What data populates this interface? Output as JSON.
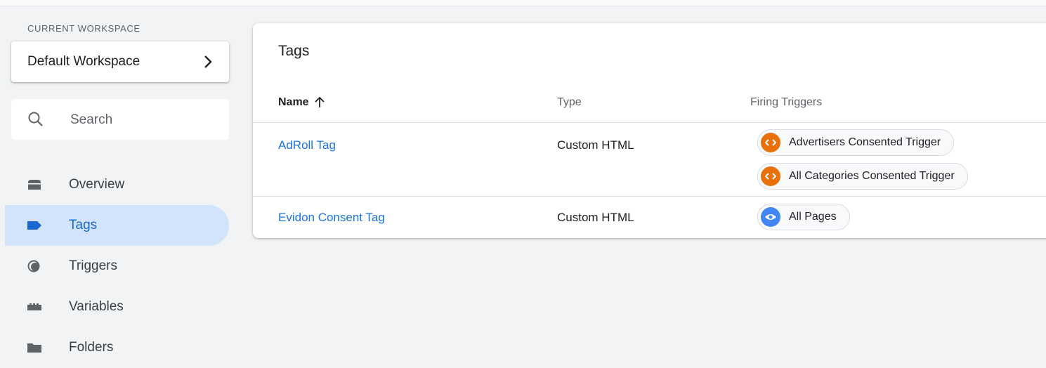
{
  "workspace": {
    "section_label": "CURRENT WORKSPACE",
    "name": "Default Workspace"
  },
  "search": {
    "placeholder": "Search"
  },
  "nav": {
    "items": [
      {
        "label": "Overview",
        "icon": "overview-icon",
        "active": false
      },
      {
        "label": "Tags",
        "icon": "tag-icon",
        "active": true
      },
      {
        "label": "Triggers",
        "icon": "trigger-icon",
        "active": false
      },
      {
        "label": "Variables",
        "icon": "variables-icon",
        "active": false
      },
      {
        "label": "Folders",
        "icon": "folder-icon",
        "active": false
      }
    ]
  },
  "main": {
    "title": "Tags",
    "columns": {
      "name": "Name",
      "type": "Type",
      "triggers": "Firing Triggers"
    },
    "sort": {
      "column": "name",
      "direction": "ascending",
      "icon": "arrow-up-icon"
    },
    "rows": [
      {
        "name": "AdRoll Tag",
        "type": "Custom HTML",
        "triggers": [
          {
            "label": "Advertisers Consented Trigger",
            "icon": "custom-code-icon",
            "color": "#e8710a"
          },
          {
            "label": "All Categories Consented Trigger",
            "icon": "custom-code-icon",
            "color": "#e8710a"
          }
        ]
      },
      {
        "name": "Evidon Consent Tag",
        "type": "Custom HTML",
        "triggers": [
          {
            "label": "All Pages",
            "icon": "eye-icon",
            "color": "#4285f4"
          }
        ]
      }
    ]
  },
  "colors": {
    "accent": "#1a73e8",
    "active_nav_bg": "#d2e3fc",
    "background": "#f1f3f4"
  }
}
